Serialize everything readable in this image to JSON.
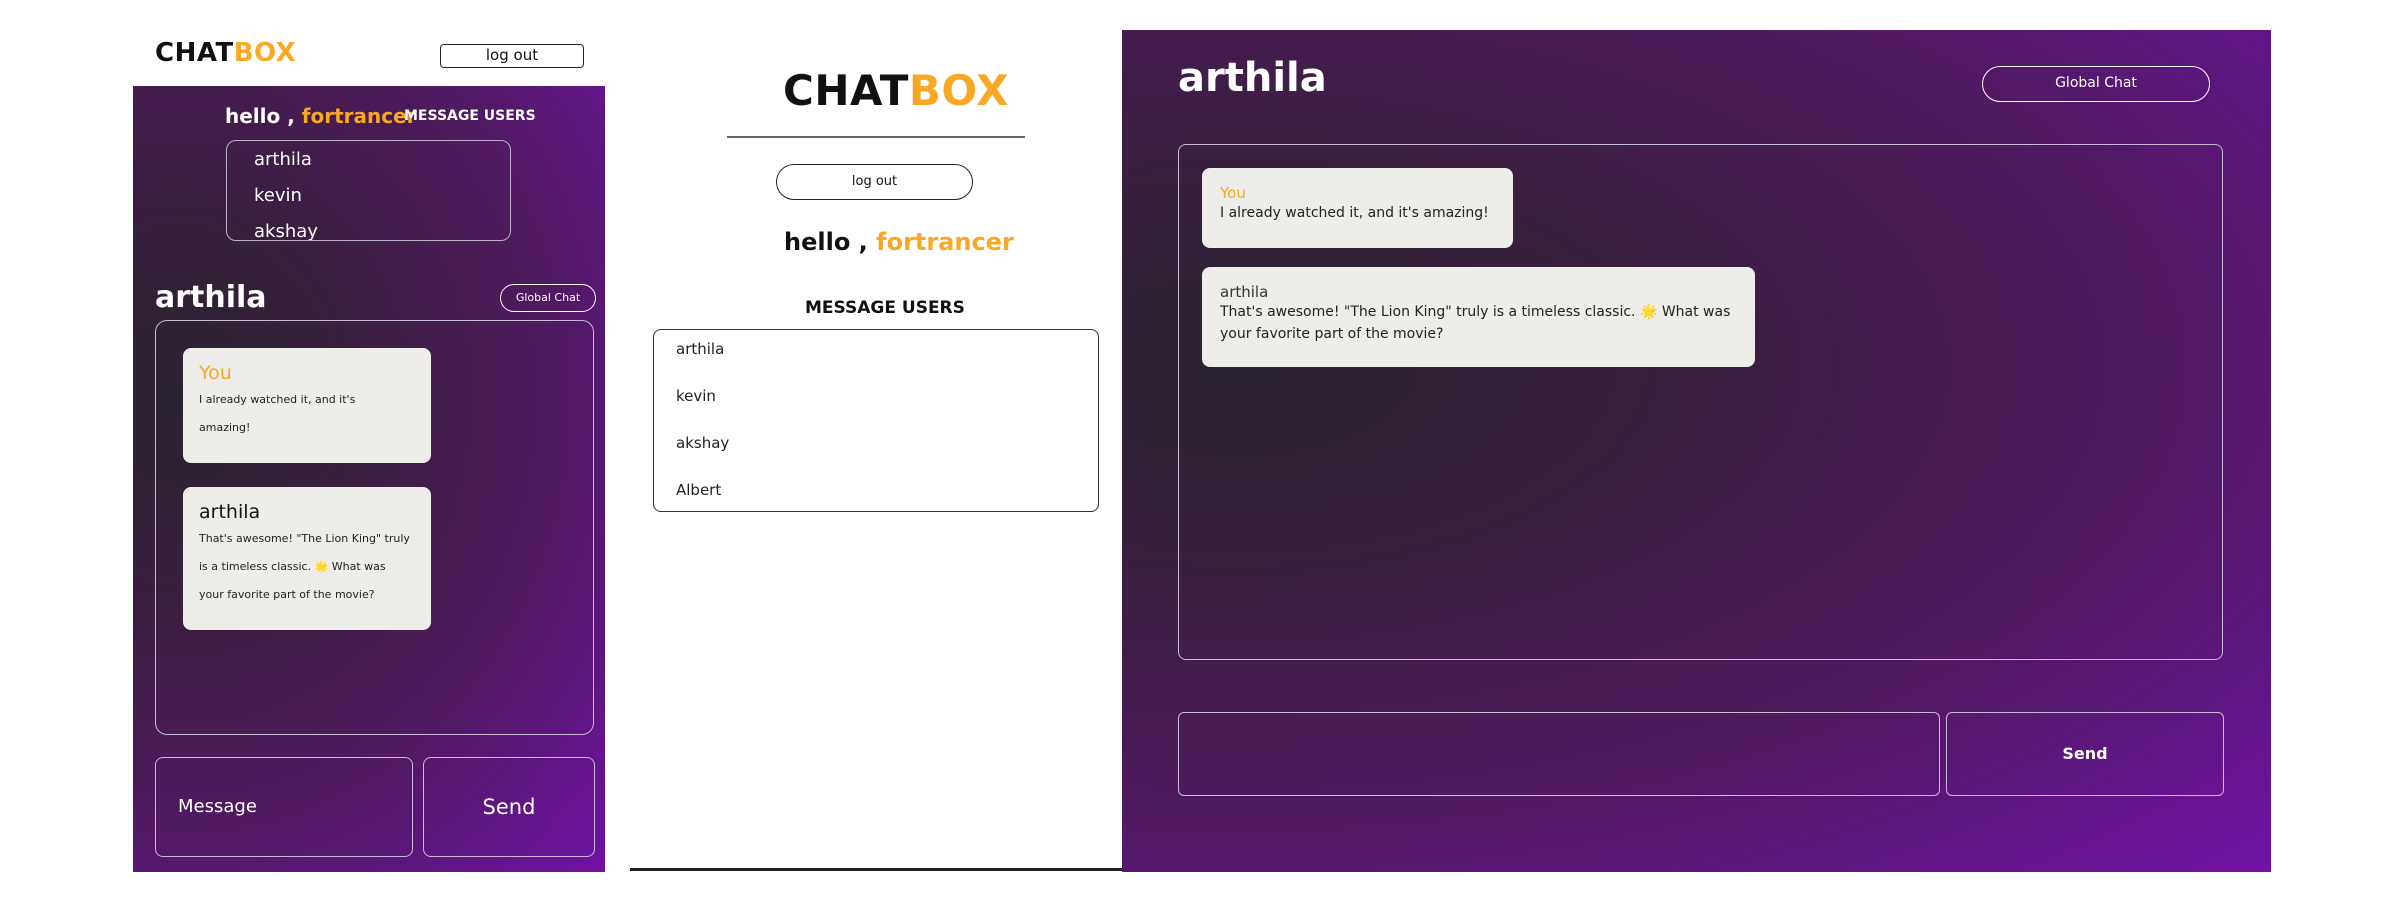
{
  "brand": {
    "logo_part1": "CHAT",
    "logo_part2": "BOX"
  },
  "user": {
    "greeting": "hello ,",
    "username": "fortrancer"
  },
  "mobile": {
    "logout_label": "log out",
    "message_users_label": "MESSAGE USERS",
    "users": [
      "arthila",
      "kevin",
      "akshay"
    ],
    "chat_title": "arthila",
    "global_chat_label": "Global Chat",
    "messages": [
      {
        "sender": "You",
        "lines": [
          "I already watched it, and it's",
          "amazing!"
        ]
      },
      {
        "sender": "arthila",
        "lines": [
          "That's awesome! \"The Lion King\" truly",
          "is a timeless classic. 🌟 What was",
          "your favorite part of the movie?"
        ]
      }
    ],
    "message_placeholder": "Message",
    "send_label": "Send"
  },
  "middle": {
    "logout_label": "log out",
    "message_users_label": "MESSAGE USERS",
    "users": [
      "arthila",
      "kevin",
      "akshay",
      "Albert"
    ]
  },
  "desktop": {
    "chat_title": "arthila",
    "global_chat_label": "Global Chat",
    "messages": [
      {
        "sender": "You",
        "lines": [
          "I already watched it, and it's amazing!"
        ]
      },
      {
        "sender": "arthila",
        "lines": [
          "That's awesome! \"The Lion King\" truly is a timeless classic. 🌟 What was",
          "your favorite part of the movie?"
        ]
      }
    ],
    "message_placeholder": "",
    "send_label": "Send"
  },
  "colors": {
    "accent": "#f9a825",
    "gradient_dark": "#2a2230",
    "gradient_purple": "#7012a4"
  }
}
